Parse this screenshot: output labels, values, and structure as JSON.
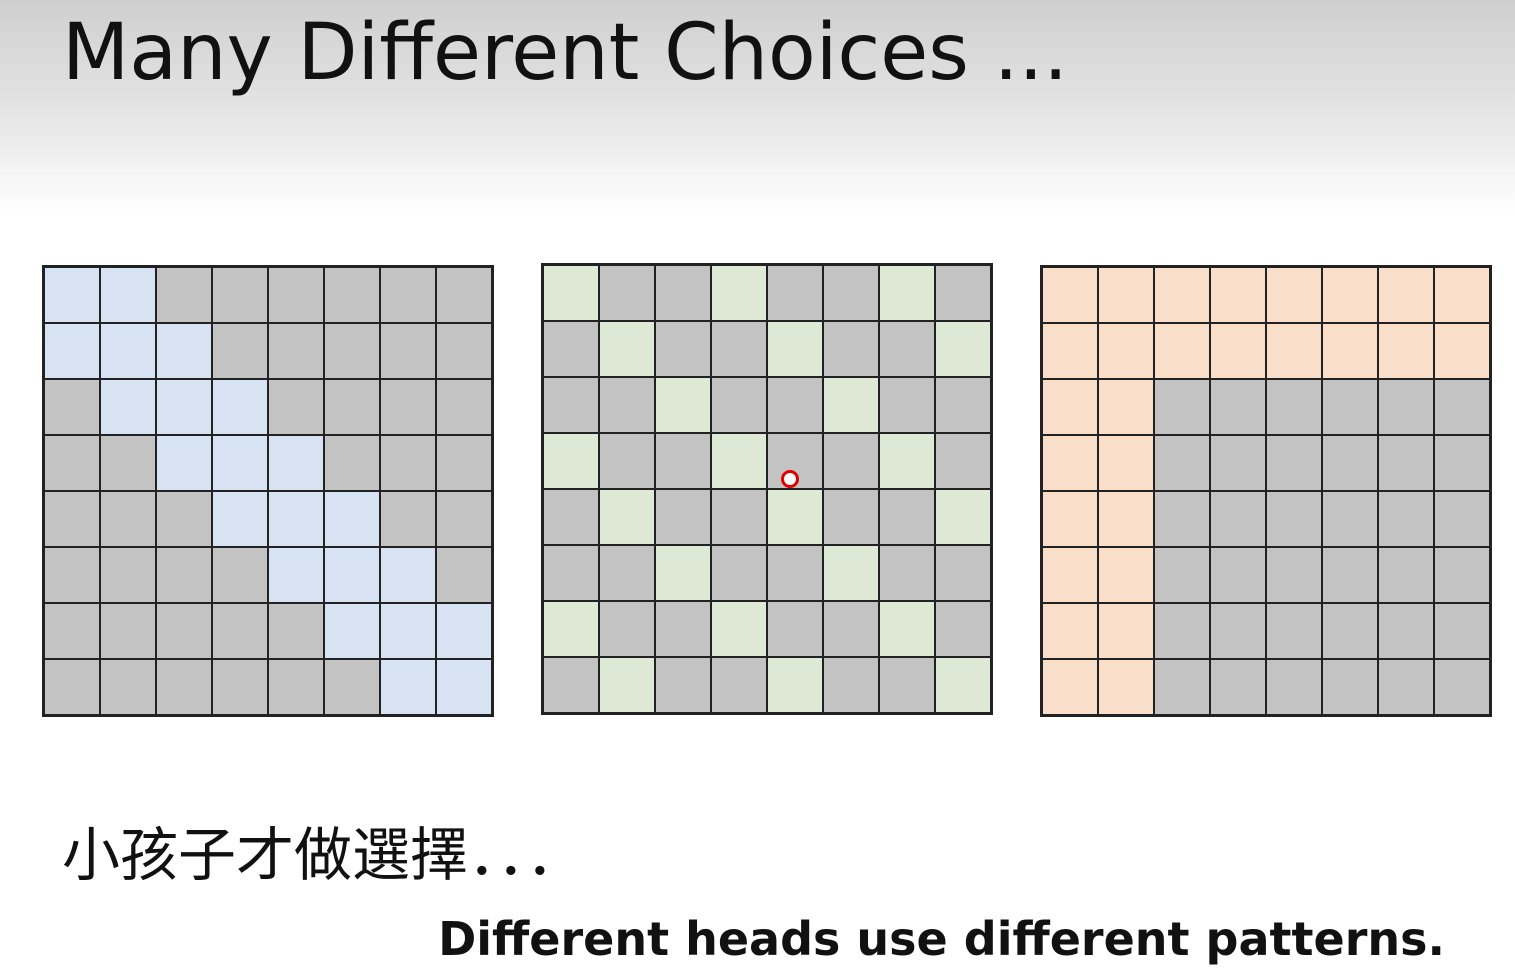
{
  "slide": {
    "title": "Many Different Choices ...",
    "subtitle": "小孩子才做選擇．．．",
    "caption": "Different heads use different patterns."
  },
  "colors": {
    "masked": "#c3c3c3",
    "grid_line": "#222222",
    "pointer": "#e00000"
  },
  "matrices": [
    {
      "name": "diagonal-band-pattern",
      "highlight_color": "#d7e3f3",
      "rows": [
        [
          1,
          1,
          0,
          0,
          0,
          0,
          0,
          0
        ],
        [
          1,
          1,
          1,
          0,
          0,
          0,
          0,
          0
        ],
        [
          0,
          1,
          1,
          1,
          0,
          0,
          0,
          0
        ],
        [
          0,
          0,
          1,
          1,
          1,
          0,
          0,
          0
        ],
        [
          0,
          0,
          0,
          1,
          1,
          1,
          0,
          0
        ],
        [
          0,
          0,
          0,
          0,
          1,
          1,
          1,
          0
        ],
        [
          0,
          0,
          0,
          0,
          0,
          1,
          1,
          1
        ],
        [
          0,
          0,
          0,
          0,
          0,
          0,
          1,
          1
        ]
      ]
    },
    {
      "name": "dilated-pattern",
      "highlight_color": "#dde9d4",
      "rows": [
        [
          1,
          0,
          0,
          1,
          0,
          0,
          1,
          0
        ],
        [
          0,
          1,
          0,
          0,
          1,
          0,
          0,
          1
        ],
        [
          0,
          0,
          1,
          0,
          0,
          1,
          0,
          0
        ],
        [
          1,
          0,
          0,
          1,
          0,
          0,
          1,
          0
        ],
        [
          0,
          1,
          0,
          0,
          1,
          0,
          0,
          1
        ],
        [
          0,
          0,
          1,
          0,
          0,
          1,
          0,
          0
        ],
        [
          1,
          0,
          0,
          1,
          0,
          0,
          1,
          0
        ],
        [
          0,
          1,
          0,
          0,
          1,
          0,
          0,
          1
        ]
      ]
    },
    {
      "name": "global-token-pattern",
      "highlight_color": "#f9dfca",
      "rows": [
        [
          1,
          1,
          1,
          1,
          1,
          1,
          1,
          1
        ],
        [
          1,
          1,
          1,
          1,
          1,
          1,
          1,
          1
        ],
        [
          1,
          1,
          0,
          0,
          0,
          0,
          0,
          0
        ],
        [
          1,
          1,
          0,
          0,
          0,
          0,
          0,
          0
        ],
        [
          1,
          1,
          0,
          0,
          0,
          0,
          0,
          0
        ],
        [
          1,
          1,
          0,
          0,
          0,
          0,
          0,
          0
        ],
        [
          1,
          1,
          0,
          0,
          0,
          0,
          0,
          0
        ],
        [
          1,
          1,
          0,
          0,
          0,
          0,
          0,
          0
        ]
      ]
    }
  ]
}
